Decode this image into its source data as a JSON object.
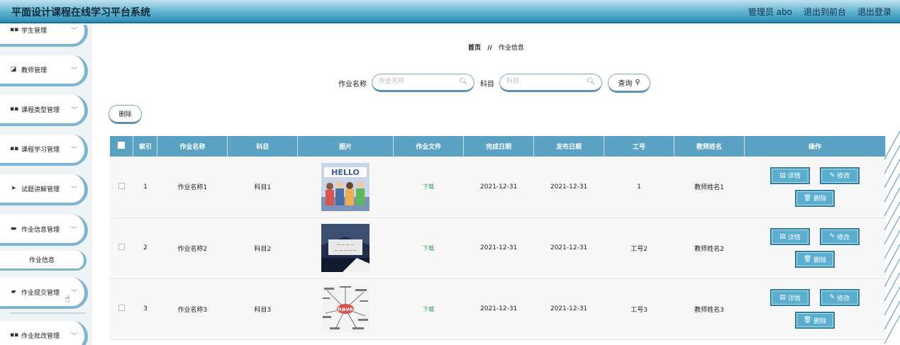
{
  "header": {
    "title": "平面设计课程在线学习平台系统",
    "user": "管理员 abo",
    "front": "退出到前台",
    "logout": "退出登录"
  },
  "sidebar": {
    "items": [
      {
        "label": "学生管理",
        "icon": "grid-icon"
      },
      {
        "label": "教师管理",
        "icon": "chart-icon"
      },
      {
        "label": "课程类型管理",
        "icon": "grid-icon"
      },
      {
        "label": "课程学习管理",
        "icon": "grid-icon"
      },
      {
        "label": "试题讲解管理",
        "icon": "send-icon"
      },
      {
        "label": "作业信息管理",
        "icon": "monitor-icon"
      },
      {
        "label": "作业提交管理",
        "icon": "message-icon"
      },
      {
        "label": "作业批改管理",
        "icon": "grid-icon"
      }
    ],
    "sub": "作业信息"
  },
  "breadcrumb": {
    "home": "首页",
    "sep": "//",
    "current": "作业信息"
  },
  "search": {
    "name_label": "作业名称",
    "name_placeholder": "作业名称",
    "subject_label": "科目",
    "subject_placeholder": "科目",
    "query": "查询"
  },
  "actions": {
    "delete": "删除"
  },
  "table": {
    "headers": [
      "索引",
      "作业名称",
      "科目",
      "图片",
      "作业文件",
      "完成日期",
      "发布日期",
      "工号",
      "教师姓名",
      "操作"
    ],
    "rows": [
      {
        "index": "1",
        "name": "作业名称1",
        "subject": "科目1",
        "file": "下载",
        "finish": "2021-12-31",
        "publish": "2021-12-31",
        "id": "1",
        "teacher": "教师姓名1",
        "image": "hello-people-image"
      },
      {
        "index": "2",
        "name": "作业名称2",
        "subject": "科目2",
        "file": "下载",
        "finish": "2021-12-31",
        "publish": "2021-12-31",
        "id": "工号2",
        "teacher": "教师姓名2",
        "image": "study-desk-image"
      },
      {
        "index": "3",
        "name": "作业名称3",
        "subject": "科目3",
        "file": "下载",
        "finish": "2021-12-31",
        "publish": "2021-12-31",
        "id": "工号3",
        "teacher": "教师姓名3",
        "image": "word-cloud-have-image"
      }
    ],
    "op_detail": "详情",
    "op_edit": "修改",
    "op_delete": "删除"
  },
  "colors": {
    "header": "#5fb3d1",
    "table_head": "#5aa2c4",
    "op_button": "#5aaed0",
    "download": "#2e9e5f"
  }
}
